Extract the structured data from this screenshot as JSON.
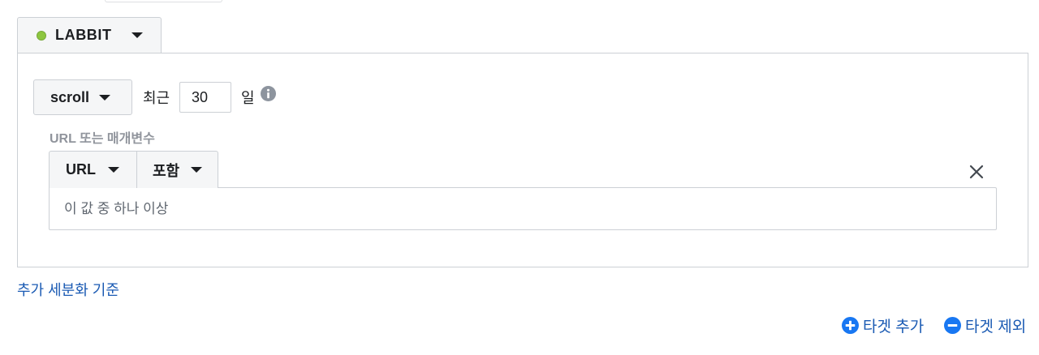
{
  "pixel": {
    "name": "LABBIT",
    "status_color": "#8dc63f"
  },
  "rule": {
    "event": "scroll",
    "recent_label": "최근",
    "days": "30",
    "days_unit": "일",
    "section_label": "URL 또는 매개변수",
    "field": "URL",
    "operator": "포함",
    "values_placeholder": "이 값 중 하나 이상"
  },
  "links": {
    "add_refinement": "추가 세분화 기준",
    "add_target": "타겟 추가",
    "remove_target": "타겟 제외"
  },
  "colors": {
    "link": "#1a5ab3",
    "icon_blue": "#1877f2",
    "muted": "#90949c"
  },
  "icons": {
    "info": "info-icon",
    "close": "close-icon",
    "add": "plus-circle-icon",
    "remove": "minus-circle-icon",
    "caret": "caret-down-icon"
  }
}
